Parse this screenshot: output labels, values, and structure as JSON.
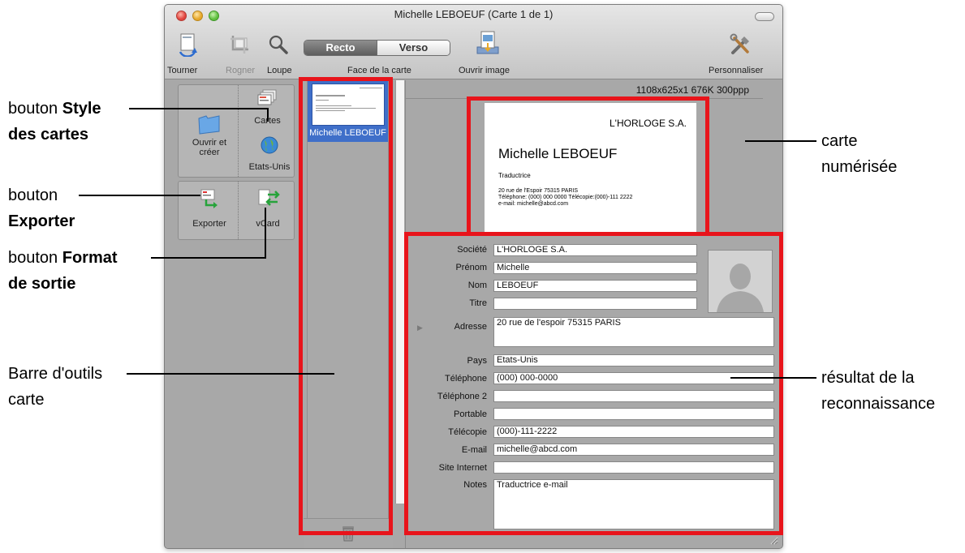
{
  "window": {
    "title": "Michelle LEBOEUF (Carte 1 de 1)"
  },
  "toolbar": {
    "rotate_label": "Tourner",
    "crop_label": "Rogner",
    "loupe_label": "Loupe",
    "face_recto": "Recto",
    "face_verso": "Verso",
    "face_label": "Face de la carte",
    "open_image_label": "Ouvrir image",
    "customize_label": "Personnaliser"
  },
  "tools": {
    "open_create_label": "Ouvrir et créer",
    "card_style_label": "Cartes",
    "country_label": "Etats-Unis",
    "export_label": "Exporter",
    "vcard_label": "vCard"
  },
  "card_list": {
    "items": [
      {
        "name": "Michelle LEBOEUF"
      }
    ]
  },
  "image_info": "1108x625x1  676K  300ppp",
  "scanned_card": {
    "company": "L'HORLOGE S.A.",
    "name": "Michelle LEBOEUF",
    "job": "Traductrice",
    "address": "20 rue de l'Espoir 75315 PARIS",
    "phone_line": "Téléphone: (000) 000 0000    Télécopie:(000)-111 2222",
    "email_line": "e-mail: michelle@abcd.com"
  },
  "fields": {
    "company": {
      "label": "Société",
      "value": "L'HORLOGE S.A."
    },
    "firstname": {
      "label": "Prénom",
      "value": "Michelle"
    },
    "lastname": {
      "label": "Nom",
      "value": "LEBOEUF"
    },
    "title": {
      "label": "Titre",
      "value": ""
    },
    "address": {
      "label": "Adresse",
      "value": "20 rue de l'espoir 75315 PARIS"
    },
    "country": {
      "label": "Pays",
      "value": "Etats-Unis"
    },
    "phone": {
      "label": "Téléphone",
      "value": "(000) 000-0000"
    },
    "phone2": {
      "label": "Téléphone 2",
      "value": ""
    },
    "mobile": {
      "label": "Portable",
      "value": ""
    },
    "fax": {
      "label": "Télécopie",
      "value": "(000)-111-2222"
    },
    "email": {
      "label": "E-mail",
      "value": "michelle@abcd.com"
    },
    "website": {
      "label": "Site Internet",
      "value": ""
    },
    "notes": {
      "label": "Notes",
      "value": "Traductrice e-mail"
    }
  },
  "callouts": {
    "style_pre": "bouton ",
    "style_bold1": "Style",
    "style_bold2": "des cartes",
    "export_pre": "bouton",
    "export_bold": "Exporter",
    "format_pre": "bouton ",
    "format_bold1": "Format",
    "format_bold2": "de sortie",
    "toolbar_line1": "Barre d'outils",
    "toolbar_line2": "carte",
    "scanned_line1": "carte",
    "scanned_line2": "numérisée",
    "result_line1": "résultat de la",
    "result_line2": "reconnaissance"
  },
  "colors": {
    "highlight_red": "#e8141b",
    "selection_blue": "#3f6fc9",
    "window_gray": "#a8a8a8"
  }
}
